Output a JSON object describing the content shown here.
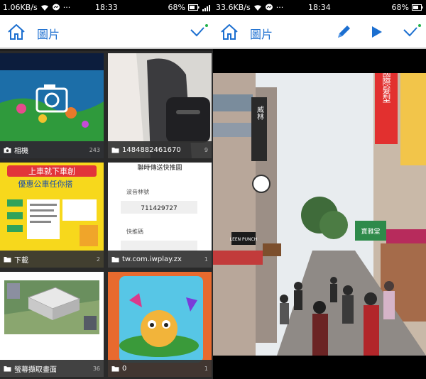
{
  "left": {
    "status": {
      "speed": "1.06KB/s",
      "time": "18:33",
      "battery": "68%"
    },
    "appbar": {
      "title": "圖片"
    },
    "albums": [
      {
        "name": "相機",
        "count": "243",
        "icon": "camera-icon"
      },
      {
        "name": "1484882461670",
        "count": "9",
        "icon": "folder-icon"
      },
      {
        "name": "下載",
        "count": "2",
        "icon": "folder-icon"
      },
      {
        "name": "tw.com.iwplay.zx",
        "count": "1",
        "icon": "folder-icon"
      },
      {
        "name": "螢幕擷取畫面",
        "count": "36",
        "icon": "folder-icon"
      },
      {
        "name": "0",
        "count": "1",
        "icon": "folder-icon"
      }
    ],
    "thumb_text": {
      "promo_title": "上車就下車創",
      "promo_sub": "優惠公車任你搭",
      "screenshot_title": "聯時傳送快推圓",
      "field1_label": "波音林號",
      "field1_value": "711429727",
      "field2_label": "快推碼"
    }
  },
  "right": {
    "status": {
      "speed": "33.6KB/s",
      "time": "18:34",
      "battery": "68%"
    },
    "appbar": {
      "title": "圖片"
    },
    "photo_signs": {
      "sign1": "國際髮型",
      "sign2": "威林",
      "sign3": "寶雅堂",
      "sign4": "LEEN PUNCH"
    }
  },
  "colors": {
    "accent": "#1c6fd0",
    "green_dot": "#22b24c"
  }
}
